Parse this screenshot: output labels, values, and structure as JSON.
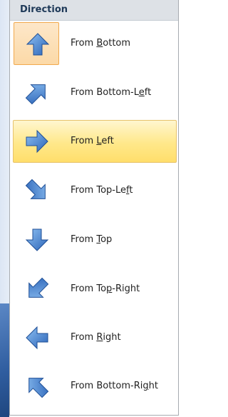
{
  "menu": {
    "title": "Direction",
    "items": [
      {
        "pre": "From ",
        "key": "B",
        "post": "ottom",
        "icon": "arrow-up-icon",
        "selected": true,
        "hover": false
      },
      {
        "pre": "From Bottom-L",
        "key": "e",
        "post": "ft",
        "icon": "arrow-up-right-icon",
        "selected": false,
        "hover": false
      },
      {
        "pre": "From ",
        "key": "L",
        "post": "eft",
        "icon": "arrow-right-icon",
        "selected": false,
        "hover": true
      },
      {
        "pre": "From Top-Le",
        "key": "f",
        "post": "t",
        "icon": "arrow-down-right-icon",
        "selected": false,
        "hover": false
      },
      {
        "pre": "From ",
        "key": "T",
        "post": "op",
        "icon": "arrow-down-icon",
        "selected": false,
        "hover": false
      },
      {
        "pre": "From To",
        "key": "p",
        "post": "-Right",
        "icon": "arrow-down-left-icon",
        "selected": false,
        "hover": false
      },
      {
        "pre": "From ",
        "key": "R",
        "post": "ight",
        "icon": "arrow-left-icon",
        "selected": false,
        "hover": false
      },
      {
        "pre": "From Bottom-Ri",
        "key": "g",
        "post": "ht",
        "icon": "arrow-up-left-icon",
        "selected": false,
        "hover": false
      }
    ]
  },
  "colors": {
    "arrow_fill_light": "#7fb0e8",
    "arrow_fill_dark": "#2b64b8",
    "hover_bg": "#ffe88a",
    "selected_bg": "#fcd9a7"
  }
}
